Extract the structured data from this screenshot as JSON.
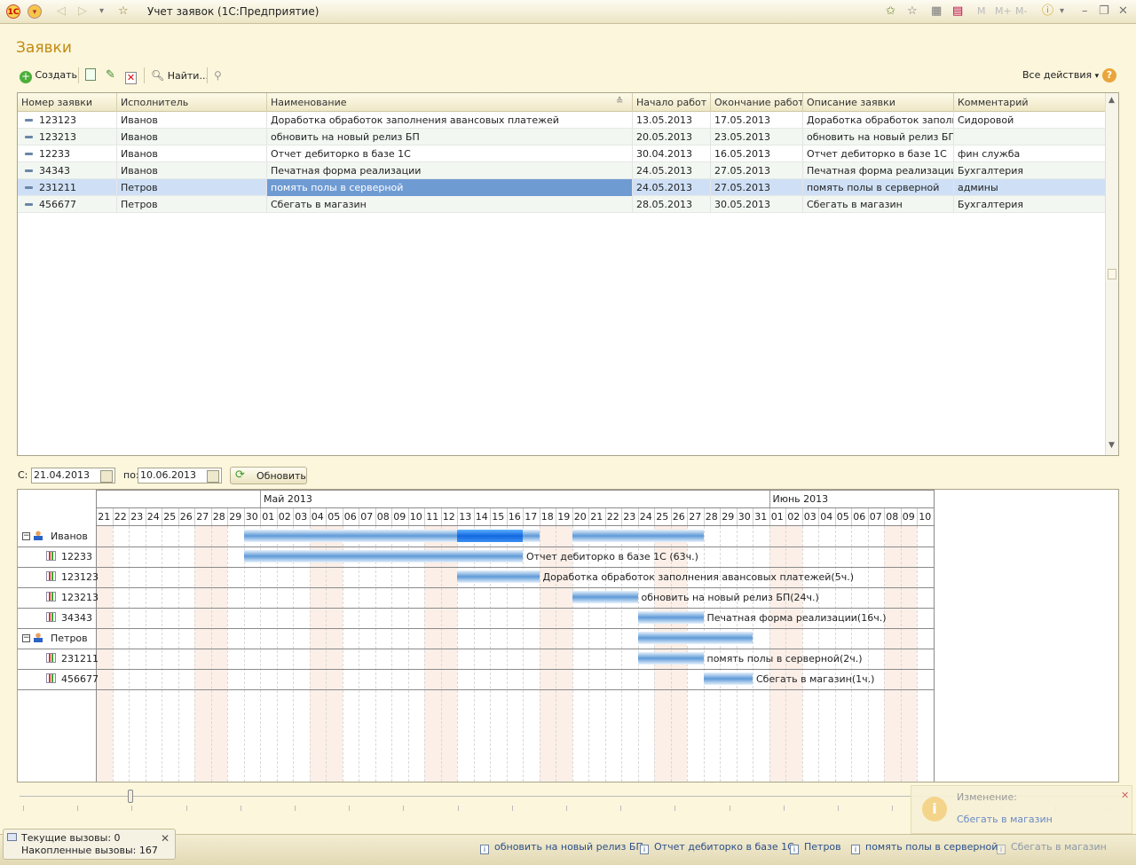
{
  "window": {
    "title": "Учет заявок  (1С:Предприятие)",
    "tool_m": "M",
    "tool_mplus": "M+",
    "tool_mminus": "M-"
  },
  "page": {
    "title": "Заявки"
  },
  "toolbar": {
    "create_label": "Создать",
    "find_label": "Найти...",
    "all_actions_label": "Все действия",
    "help_label": "?"
  },
  "table": {
    "columns": [
      "Номер заявки",
      "Исполнитель",
      "Наименование",
      "Начало работ",
      "Окончание работ",
      "Описание заявки",
      "Комментарий"
    ],
    "rows": [
      [
        "123123",
        "Иванов",
        "Доработка обработок заполнения авансовых платежей",
        "13.05.2013",
        "17.05.2013",
        "Доработка обработок заполн...",
        "Сидоровой"
      ],
      [
        "123213",
        "Иванов",
        "обновить на новый релиз БП",
        "20.05.2013",
        "23.05.2013",
        "обновить на новый релиз БП ...",
        ""
      ],
      [
        "12233",
        "Иванов",
        "Отчет дебиторко в базе 1С",
        "30.04.2013",
        "16.05.2013",
        "Отчет дебиторко в базе 1С",
        "фин служба"
      ],
      [
        "34343",
        "Иванов",
        "Печатная форма реализации",
        "24.05.2013",
        "27.05.2013",
        "Печатная форма реализации",
        "Бухгалтерия"
      ],
      [
        "231211",
        "Петров",
        "помять полы в серверной",
        "24.05.2013",
        "27.05.2013",
        "помять полы в серверной",
        "админы"
      ],
      [
        "456677",
        "Петров",
        "Сбегать в магазин",
        "28.05.2013",
        "30.05.2013",
        "Сбегать в магазин",
        "Бухгалтерия"
      ]
    ],
    "selected_row": 4
  },
  "period": {
    "from_label": "С:",
    "from_value": "21.04.2013",
    "to_label": "по:",
    "to_value": "10.06.2013",
    "refresh_label": "Обновить"
  },
  "gantt": {
    "months": [
      "Май 2013",
      "Июнь 2013"
    ],
    "days": [
      "21",
      "22",
      "23",
      "24",
      "25",
      "26",
      "27",
      "28",
      "29",
      "30",
      "01",
      "02",
      "03",
      "04",
      "05",
      "06",
      "07",
      "08",
      "09",
      "10",
      "11",
      "12",
      "13",
      "14",
      "15",
      "16",
      "17",
      "18",
      "19",
      "20",
      "21",
      "22",
      "23",
      "24",
      "25",
      "26",
      "27",
      "28",
      "29",
      "30",
      "31",
      "01",
      "02",
      "03",
      "04",
      "05",
      "06",
      "07",
      "08",
      "09",
      "10"
    ],
    "rows": [
      {
        "label": "Иванов",
        "kind": "group"
      },
      {
        "label": "12233",
        "kind": "task",
        "text": "Отчет дебиторко в базе 1С (63ч.)"
      },
      {
        "label": "123123",
        "kind": "task",
        "text": "Доработка обработок заполнения авансовых платежей(5ч.)"
      },
      {
        "label": "123213",
        "kind": "task",
        "text": "обновить на новый релиз БП(24ч.)"
      },
      {
        "label": "34343",
        "kind": "task",
        "text": "Печатная форма реализации(16ч.)"
      },
      {
        "label": "Петров",
        "kind": "group"
      },
      {
        "label": "231211",
        "kind": "task",
        "text": "помять полы в серверной(2ч.)"
      },
      {
        "label": "456677",
        "kind": "task",
        "text": "Сбегать в магазин(1ч.)"
      }
    ]
  },
  "statusbar": {
    "current_calls": "Текущие вызовы: 0",
    "accumulated_calls": "Накопленные вызовы: 167",
    "history": [
      "обновить на новый релиз БП",
      "Отчет дебиторко в базе 1С",
      "Петров",
      "помять полы в серверной",
      "Сбегать в магазин"
    ]
  },
  "notification": {
    "title": "Изменение:",
    "link": "Сбегать в магазин"
  }
}
